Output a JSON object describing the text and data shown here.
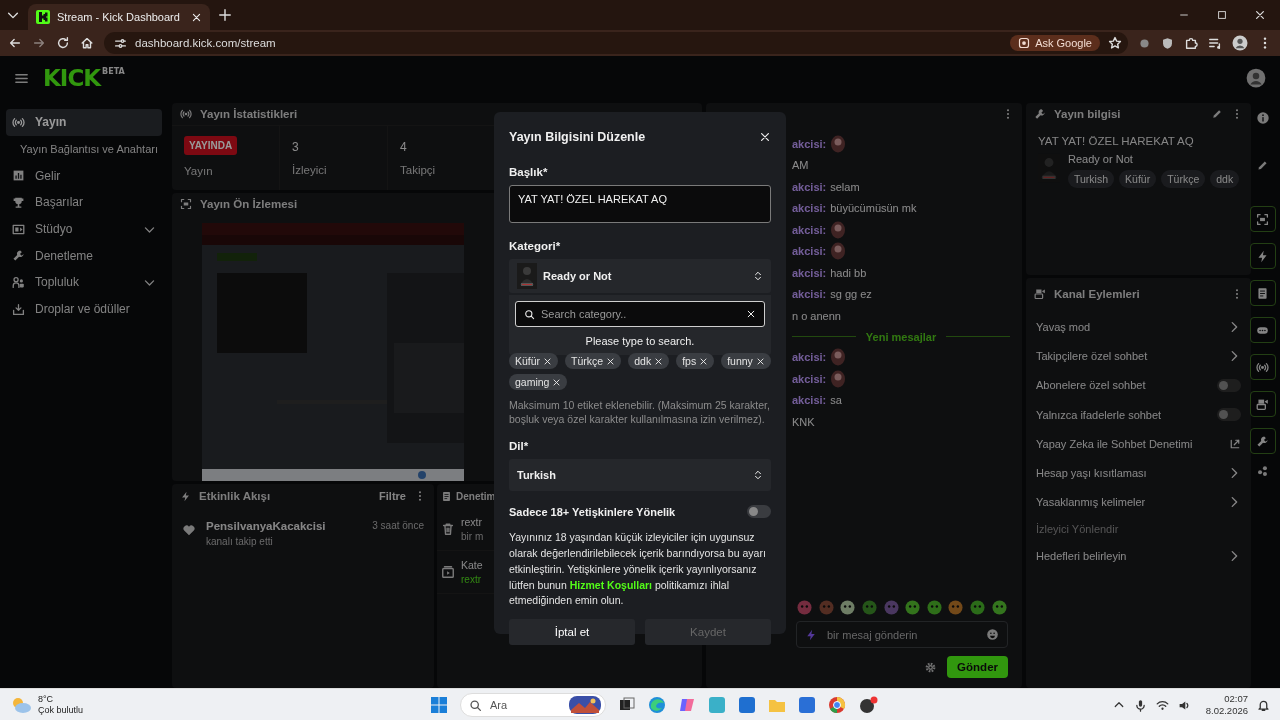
{
  "browser": {
    "tab_title": "Stream - Kick Dashboard",
    "url": "dashboard.kick.com/stream",
    "ask_button": "Ask Google"
  },
  "header": {
    "logo": "KICK",
    "logo_badge": "BETA"
  },
  "sidebar": {
    "items": [
      {
        "label": "Yayın",
        "selected": true,
        "children": [
          {
            "label": "Yayın Bağlantısı ve Anahtarı",
            "selected": false
          }
        ]
      },
      {
        "label": "Gelir",
        "selected": false
      },
      {
        "label": "Başarılar",
        "selected": false
      },
      {
        "label": "Stüdyo",
        "selected": false,
        "expanded": false
      },
      {
        "label": "Denetleme",
        "selected": false
      },
      {
        "label": "Topluluk",
        "selected": false,
        "expanded": false
      },
      {
        "label": "Droplar ve ödüller",
        "selected": false
      }
    ]
  },
  "stats": {
    "title": "Yayın İstatistikleri",
    "badge": "YAYINDA",
    "badge_label": "Yayın",
    "items": [
      {
        "value": "3",
        "label": "İzleyici"
      },
      {
        "value": "4",
        "label": "Takipçi"
      }
    ]
  },
  "preview": {
    "title": "Yayın Ön İzlemesi"
  },
  "events": {
    "title": "Etkinlik Akışı",
    "filter": "Filtre",
    "items": [
      {
        "user": "PensilvanyaKacakcisi",
        "action": "kanalı takip etti",
        "time": "3 saat önce"
      }
    ]
  },
  "moderation": {
    "title": "Denetim",
    "items": [
      {
        "kind": "delete",
        "title": "rextr",
        "subtitle": "bir m"
      },
      {
        "kind": "category",
        "title": "Kate",
        "subtitle": "rextr"
      }
    ]
  },
  "chat": {
    "messages": [
      {
        "user": "akcisi:",
        "kind": "emote"
      },
      {
        "text": "AM"
      },
      {
        "user": "akcisi:",
        "text": "selam"
      },
      {
        "user": "akcisi:",
        "text": "büyücümüsün mk"
      },
      {
        "user": "akcisi:",
        "kind": "emote"
      },
      {
        "user": "akcisi:",
        "kind": "emote"
      },
      {
        "user": "akcisi:",
        "text": "hadi bb"
      },
      {
        "user": "akcisi:",
        "text": "sg gg ez"
      },
      {
        "text": "n o anenn"
      },
      {
        "kind": "divider",
        "text": "Yeni mesajlar"
      },
      {
        "user": "akcisi:",
        "kind": "emote"
      },
      {
        "user": "akcisi:",
        "kind": "emote"
      },
      {
        "user": "akcisi:",
        "text": "sa"
      },
      {
        "text": "KNK"
      }
    ],
    "placeholder": "bir mesaj gönderin",
    "send": "Gönder"
  },
  "info": {
    "title": "Yayın bilgisi",
    "stream_title": "YAT YAT! ÖZEL HAREKAT AQ",
    "category": "Ready or Not",
    "tags": [
      "Turkish",
      "Küfür",
      "Türkçe",
      "ddk"
    ]
  },
  "actions": {
    "title": "Kanal Eylemleri",
    "items": [
      {
        "kind": "link",
        "label": "Yavaş mod",
        "disabled": false
      },
      {
        "kind": "link",
        "label": "Takipçilere özel sohbet",
        "disabled": false
      },
      {
        "kind": "toggle",
        "label": "Abonelere özel sohbet",
        "on": false,
        "disabled": false
      },
      {
        "kind": "toggle",
        "label": "Yalnızca ifadelerle sohbet",
        "on": false,
        "disabled": false
      },
      {
        "kind": "external",
        "label": "Yapay Zeka ile Sohbet Denetimi",
        "disabled": false
      },
      {
        "kind": "link",
        "label": "Hesap yaşı kısıtlaması",
        "disabled": false
      },
      {
        "kind": "link",
        "label": "Yasaklanmış kelimeler",
        "disabled": false
      },
      {
        "kind": "plain",
        "label": "İzleyici Yönlendir",
        "disabled": true
      },
      {
        "kind": "link",
        "label": "Hedefleri belirleyin",
        "disabled": false
      }
    ]
  },
  "modal": {
    "title": "Yayın Bilgisini Düzenle",
    "title_label": "Başlık*",
    "title_value": "YAT YAT! ÖZEL HAREKAT AQ",
    "category_label": "Kategori*",
    "category": "Ready or Not",
    "search_placeholder": "Search category..",
    "search_hint": "Please type to search.",
    "tags": [
      "Küfür",
      "Türkçe",
      "ddk",
      "fps",
      "funny",
      "gaming"
    ],
    "tags_hint": "Maksimum 10 etiket eklenebilir. (Maksimum 25 karakter, boşluk veya özel karakter kullanılmasına izin verilmez).",
    "language_label": "Dil*",
    "language": "Turkish",
    "adult": {
      "label": "Sadece 18+ Yetişkinlere Yönelik",
      "on": false
    },
    "notice": "Yayınınız 18 yaşından küçük izleyiciler için uygunsuz olarak değerlendirilebilecek içerik barındıyorsa bu ayarı etkinleştirin. Yetişkinlere yönelik içerik yayınlıyorsanız lütfen bunun",
    "terms_link": "Hizmet Koşulları",
    "notice_end": "politikamızı ihlal etmediğinden emin olun.",
    "buttons": [
      {
        "label": "İptal et",
        "disabled": false
      },
      {
        "label": "Kaydet",
        "disabled": true
      }
    ]
  },
  "taskbar": {
    "temp": "8°C",
    "weather": "Çok bulutlu",
    "search": "Ara",
    "time": "02:07",
    "date": "8.02.2026"
  }
}
